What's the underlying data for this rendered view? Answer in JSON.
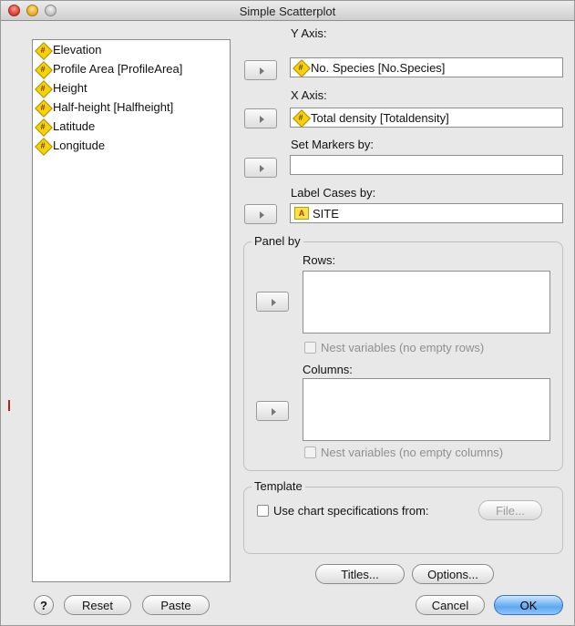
{
  "window": {
    "title": "Simple Scatterplot"
  },
  "variables": [
    {
      "label": "Elevation",
      "type": "scale"
    },
    {
      "label": "Profile Area [ProfileArea]",
      "type": "scale"
    },
    {
      "label": "Height",
      "type": "scale"
    },
    {
      "label": "Half-height [Halfheight]",
      "type": "scale"
    },
    {
      "label": "Latitude",
      "type": "scale"
    },
    {
      "label": "Longitude",
      "type": "scale"
    }
  ],
  "y_axis": {
    "label": "Y Axis:",
    "value": "No. Species [No.Species]",
    "icon": "scale"
  },
  "x_axis": {
    "label": "X Axis:",
    "value": "Total density [Totaldensity]",
    "icon": "scale"
  },
  "set_markers": {
    "label": "Set Markers by:",
    "value": ""
  },
  "label_cases": {
    "label": "Label Cases by:",
    "value": "SITE",
    "icon": "nominal",
    "icon_text": "A"
  },
  "panel_by": {
    "title": "Panel by",
    "rows_label": "Rows:",
    "nest_rows": "Nest variables (no empty rows)",
    "columns_label": "Columns:",
    "nest_columns": "Nest variables (no empty columns)"
  },
  "template": {
    "title": "Template",
    "use_chart_spec": "Use chart specifications from:",
    "file_button": "File..."
  },
  "buttons": {
    "titles": "Titles...",
    "options": "Options...",
    "help": "?",
    "reset": "Reset",
    "paste": "Paste",
    "cancel": "Cancel",
    "ok": "OK"
  },
  "icon_glyphs": {
    "scale": "#",
    "nominal": "A"
  },
  "colors": {
    "scale_icon": "#f5d20a",
    "ok_button": "#5ea8f0"
  }
}
